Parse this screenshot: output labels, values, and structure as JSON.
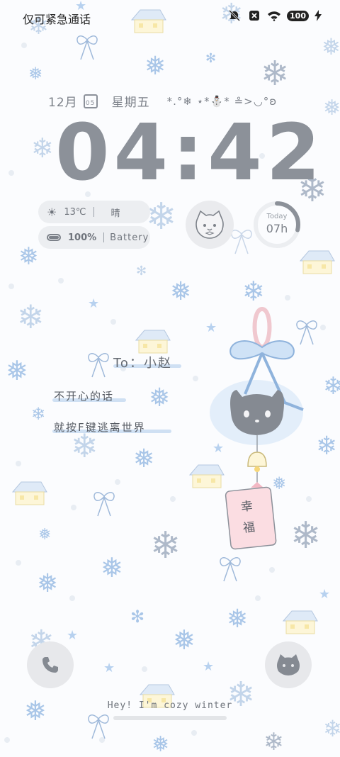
{
  "status_bar": {
    "left_text": "仅可紧急通话",
    "battery": "100",
    "icons": [
      "mute-icon",
      "no-sim-icon",
      "wifi-icon",
      "battery-icon",
      "charging-icon"
    ]
  },
  "date": {
    "month": "12月",
    "calendar_day": "05",
    "weekday": "星期五",
    "kaomoji": "*.°❄ ⋆*⛄* ≗>◡°ʚ"
  },
  "clock": {
    "time": "04:42"
  },
  "widgets": {
    "weather": {
      "temp": "13℃",
      "condition": "晴",
      "icon": "sun-icon"
    },
    "battery": {
      "percent": "100%",
      "label": "Battery"
    },
    "today": {
      "label": "Today",
      "value": "07h",
      "progress": 0.29
    }
  },
  "note": {
    "to": "To：小赵",
    "line1": "不开心的话",
    "line2": "就按F键逃离世界"
  },
  "charm": {
    "text": "幸福"
  },
  "footer": {
    "text": "Hey! I'm cozy winter"
  },
  "colors": {
    "background": "#fbfcfe",
    "clock": "#8c9199",
    "accent_blue": "#a9c6e8",
    "pill_bg": "#eceef1"
  }
}
